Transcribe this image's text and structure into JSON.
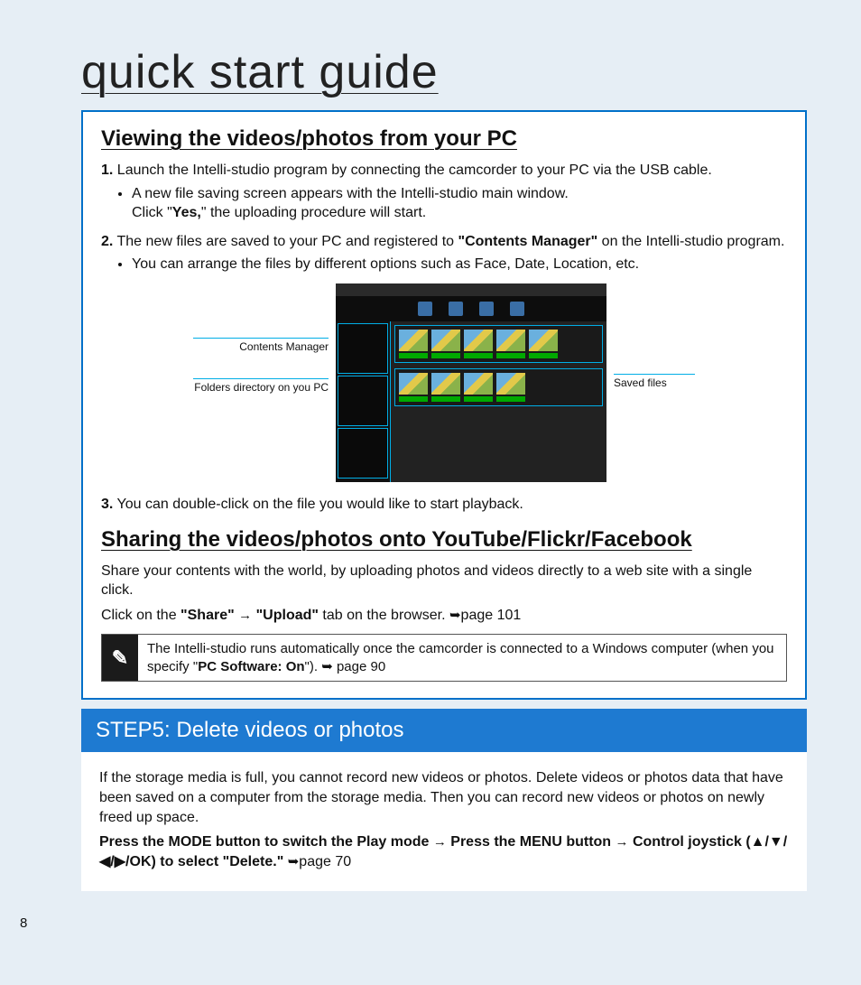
{
  "title": "quick start guide",
  "page_number": "8",
  "section1": {
    "heading": "Viewing the videos/photos from your PC",
    "step1_num": "1.",
    "step1": "Launch the Intelli-studio program by connecting the camcorder to your PC via the USB cable.",
    "step1_bullet_a": "A new file saving screen appears with the Intelli-studio main window.",
    "step1_bullet_b_pre": "Click \"",
    "step1_bullet_b_bold": "Yes,",
    "step1_bullet_b_post": "\" the uploading procedure will start.",
    "step2_num": "2.",
    "step2_pre": "The new files are saved to your PC and registered to ",
    "step2_bold": "\"Contents Manager\"",
    "step2_post": "  on the Intelli-studio program.",
    "step2_bullet": "You can arrange the files by different options such as Face, Date, Location, etc.",
    "label_left1": "Contents Manager",
    "label_left2": "Folders directory on you PC",
    "label_right": "Saved files",
    "step3_num": "3.",
    "step3": "You can double-click on the file you would like to start playback."
  },
  "section2": {
    "heading": "Sharing the videos/photos onto YouTube/Flickr/Facebook",
    "para1": "Share your contents with the world, by uploading photos and videos directly to a web site with a single click.",
    "para2_pre": "Click on the ",
    "para2_b1": "\"Share\" ",
    "para2_arrow": "→",
    "para2_b2": " \"Upload\"",
    "para2_post": " tab on the browser. ",
    "para2_ref_arrow": "➥",
    "para2_ref": "page 101",
    "note_pre": "The Intelli-studio runs automatically once the camcorder is connected to a Windows computer (when you specify \"",
    "note_bold": "PC Software: On",
    "note_post": "\"). ",
    "note_arrow": "➥",
    "note_ref": " page 90"
  },
  "step5": {
    "heading": "STEP5: Delete videos or photos",
    "para1": "If the storage media is full, you cannot record new videos or photos. Delete videos or photos data that have been saved on a computer from the storage media. Then you can record new videos or photos on newly freed up space.",
    "para2_b1": "Press the MODE button to switch the Play mode ",
    "para2_a1": "→",
    "para2_b2": " Press the MENU button ",
    "para2_a2": "→",
    "para2_b3": " Control joystick (▲/▼/◀/▶/OK) to select \"Delete.\" ",
    "para2_arrow": "➥",
    "para2_ref": "page 70"
  }
}
